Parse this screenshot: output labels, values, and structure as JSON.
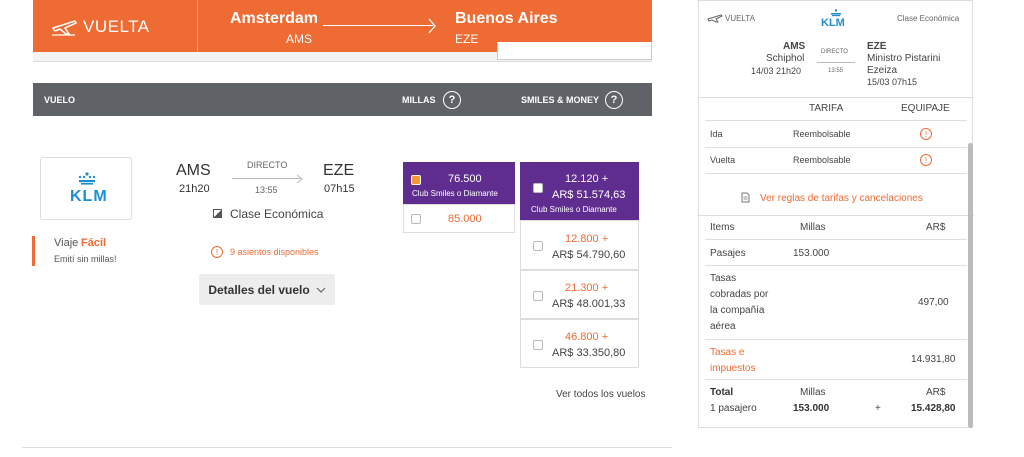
{
  "header": {
    "direction_label": "VUELTA",
    "origin_city": "Amsterdam",
    "origin_code": "AMS",
    "dest_city": "Buenos Aires",
    "dest_code": "EZE"
  },
  "columns": {
    "vuelo": "VUELO",
    "millas": "MILLAS",
    "smiles_money": "SMILES & MONEY",
    "help_glyph": "?"
  },
  "flight": {
    "airline_logo_text": "KLM",
    "origin_code": "AMS",
    "origin_time": "21h20",
    "stop_type": "DIRECTO",
    "duration": "13:55",
    "dest_code": "EZE",
    "dest_time": "07h15",
    "cabin_class": "Clase Económica",
    "seats_available": "9 asientos disponibles",
    "promo_title_a": "Viaje",
    "promo_title_b": "Fácil",
    "promo_sub": "Emití sin millas!",
    "details_button": "Detalles del vuelo"
  },
  "millas_options": [
    {
      "miles": "76.500",
      "note": "Club Smiles o Diamante",
      "selected": true
    },
    {
      "miles": "85.000",
      "note": "",
      "selected": false
    }
  ],
  "money_options": [
    {
      "miles": "12.120 +",
      "money": "AR$ 51.574,63",
      "note": "Club Smiles o Diamante",
      "selected": true
    },
    {
      "miles": "12.800 +",
      "money": "AR$ 54.790,60",
      "note": "",
      "selected": false
    },
    {
      "miles": "21.300 +",
      "money": "AR$ 48.001,33",
      "note": "",
      "selected": false
    },
    {
      "miles": "46.800 +",
      "money": "AR$ 33.350,80",
      "note": "",
      "selected": false
    }
  ],
  "see_all": "Ver todos los vuelos",
  "summary": {
    "direction_label": "VUELTA",
    "airline_logo_text": "KLM",
    "cabin": "Clase Económica",
    "origin_code": "AMS",
    "origin_airport": "Schiphol",
    "origin_datetime": "14/03 21h20",
    "stop_type": "DIRECTO",
    "duration": "13:55",
    "dest_code": "EZE",
    "dest_airport_1": "Ministro Pistarini",
    "dest_airport_2": "Ezeiza",
    "dest_datetime": "15/03 07h15",
    "col_tarifa": "TARIFA",
    "col_equipaje": "EQUIPAJE",
    "rows": [
      {
        "label": "Ida",
        "tarifa": "Reembolsable"
      },
      {
        "label": "Vuelta",
        "tarifa": "Reembolsable"
      }
    ],
    "rules_link": "Ver reglas de tarifas y cancelaciones",
    "items_header": {
      "items": "Items",
      "millas": "Millas",
      "ars": "AR$"
    },
    "pasajes": {
      "label": "Pasajes",
      "millas": "153.000"
    },
    "tasas_label_1": "Tasas",
    "tasas_label_2": "cobradas por",
    "tasas_label_3": "la compañía",
    "tasas_label_4": "aérea",
    "tasas_value": "497,00",
    "impuestos_label_1": "Tasas e",
    "impuestos_label_2": "impuestos",
    "impuestos_value": "14.931,80",
    "total": {
      "label": "Total",
      "sub": "1 pasajero",
      "millas_label": "Millas",
      "millas": "153.000",
      "plus": "+",
      "ars_label": "AR$",
      "ars": "15.428,80"
    }
  },
  "colors": {
    "accent": "#ee6b33",
    "purple": "#5f2d8f",
    "header_gray": "#5f6367",
    "klm_blue": "#1d8fd1"
  }
}
